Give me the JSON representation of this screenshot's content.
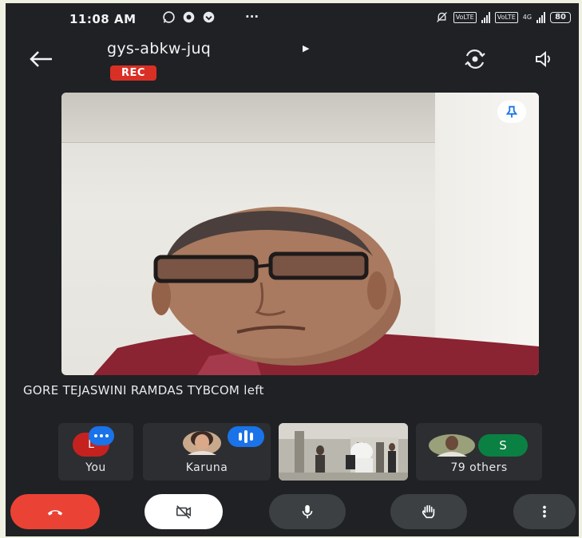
{
  "status_bar": {
    "time": "11:08 AM",
    "more": "···",
    "battery": "80",
    "sim_badge_1": "VoLTE",
    "sim_badge_2": "VoLTE",
    "network": "4G"
  },
  "header": {
    "meeting_code": "gys-abkw-juq",
    "rec_label": "REC"
  },
  "caption": "GORE TEJASWINI RAMDAS TYBCOM left",
  "participants": {
    "you": {
      "initial": "L",
      "label": "You"
    },
    "karuna": {
      "label": "Karuna"
    },
    "others": {
      "initial": "S",
      "label": "79 others"
    }
  },
  "colors": {
    "background": "#202124",
    "rec": "#d93025",
    "end_call": "#ea4335",
    "speaking": "#1a73e8",
    "avatar_L": "#c5221f",
    "avatar_S": "#0b8043"
  }
}
